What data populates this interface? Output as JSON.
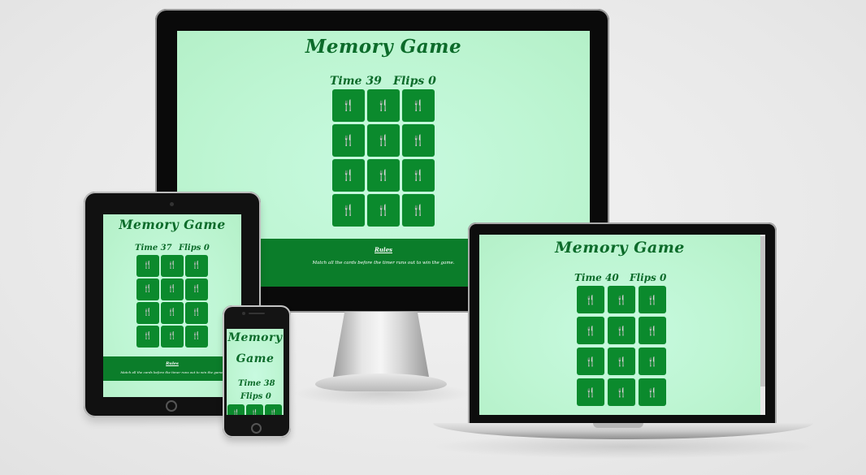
{
  "game_title": "Memory Game",
  "time_label": "Time",
  "flips_label": "Flips",
  "card_icon": "fork-knife-icon",
  "card_glyph": "🍴",
  "colors": {
    "card": "#0b8a2d",
    "title": "#0c6b2a",
    "screen": "#bdf5d2",
    "footer": "#0b7d2a"
  },
  "footer": {
    "link": "Rules",
    "text": "Match all the cards before the timer runs out to win the game."
  },
  "devices": {
    "monitor": {
      "time": "39",
      "flips": "0"
    },
    "tablet": {
      "time": "37",
      "flips": "0"
    },
    "laptop": {
      "time": "40",
      "flips": "0"
    },
    "phone": {
      "title_line1": "Memory",
      "title_line2": "Game",
      "time": "38",
      "flips": "0"
    }
  }
}
